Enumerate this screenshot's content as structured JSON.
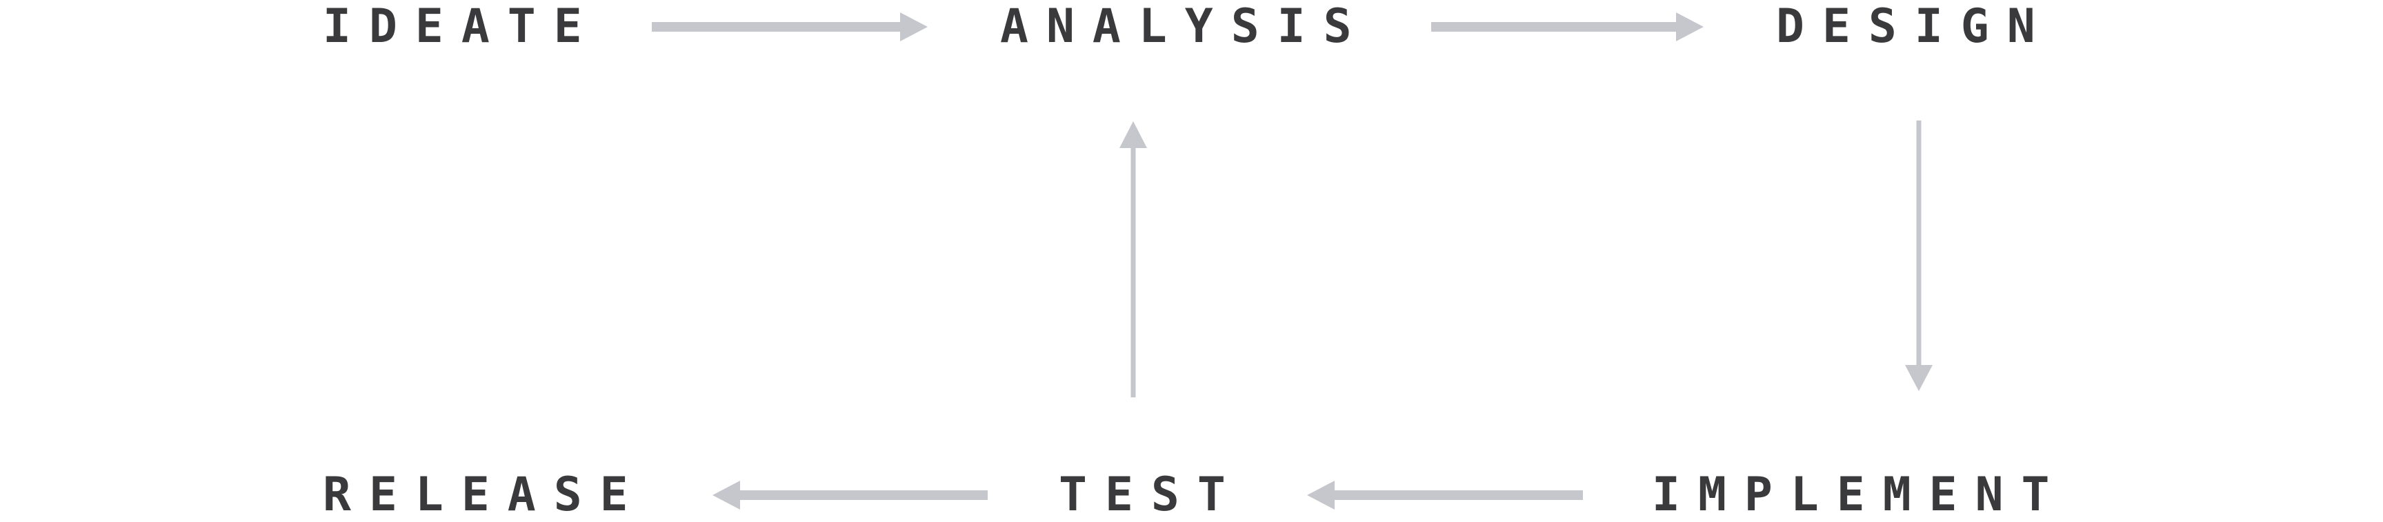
{
  "diagram": {
    "nodes": {
      "ideate": "IDEATE",
      "analysis": "ANALYSIS",
      "design": "DESIGN",
      "implement": "IMPLEMENT",
      "test": "TEST",
      "release": "RELEASE"
    },
    "edges": [
      {
        "from": "ideate",
        "to": "analysis"
      },
      {
        "from": "analysis",
        "to": "design"
      },
      {
        "from": "design",
        "to": "implement"
      },
      {
        "from": "implement",
        "to": "test"
      },
      {
        "from": "test",
        "to": "release"
      },
      {
        "from": "test",
        "to": "analysis"
      }
    ],
    "colors": {
      "text": "#3a3a3c",
      "arrow": "#c6c7cc",
      "background": "#ffffff"
    }
  }
}
